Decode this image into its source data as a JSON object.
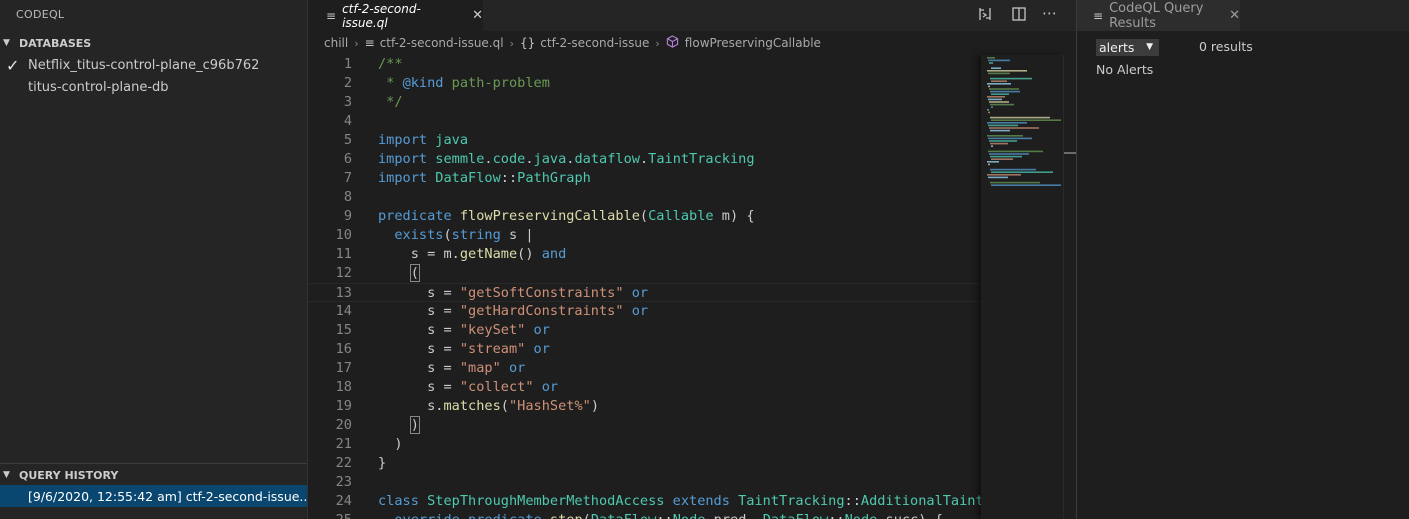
{
  "sidebar": {
    "title": "CODEQL",
    "databases": {
      "header": "DATABASES",
      "items": [
        {
          "label": "Netflix_titus-control-plane_c96b762",
          "selected": true
        },
        {
          "label": "titus-control-plane-db",
          "selected": false
        }
      ]
    },
    "query_history": {
      "header": "QUERY HISTORY",
      "items": [
        {
          "label": "[9/6/2020, 12:55:42 am] ctf-2-second-issue...."
        }
      ]
    }
  },
  "editor": {
    "tab": {
      "label": "ctf-2-second-issue.ql"
    },
    "breadcrumb": [
      "chill",
      "ctf-2-second-issue.ql",
      "ctf-2-second-issue",
      "flowPreservingCallable"
    ],
    "lines": [
      {
        "n": "1",
        "html": "<span class=\"cm\">/**</span>"
      },
      {
        "n": "2",
        "html": "<span class=\"cm\"> * </span><span class=\"kw\">@kind</span><span class=\"cm\"> path-problem</span>"
      },
      {
        "n": "3",
        "html": "<span class=\"cm\"> */</span>"
      },
      {
        "n": "4",
        "html": ""
      },
      {
        "n": "5",
        "html": "<span class=\"kw\">import</span> <span class=\"ty\">java</span>"
      },
      {
        "n": "6",
        "html": "<span class=\"kw\">import</span> <span class=\"ty\">semmle</span>.<span class=\"ty\">code</span>.<span class=\"ty\">java</span>.<span class=\"ty\">dataflow</span>.<span class=\"ty\">TaintTracking</span>"
      },
      {
        "n": "7",
        "html": "<span class=\"kw\">import</span> <span class=\"ty\">DataFlow</span>::<span class=\"ty\">PathGraph</span>"
      },
      {
        "n": "8",
        "html": ""
      },
      {
        "n": "9",
        "html": "<span class=\"kw\">predicate</span> <span class=\"fn\">flowPreservingCallable</span>(<span class=\"ty\">Callable</span> m) {"
      },
      {
        "n": "10",
        "html": "  <span class=\"kw\">exists</span>(<span class=\"kw\">string</span> s |"
      },
      {
        "n": "11",
        "html": "    s = m.<span class=\"fn\">getName</span>() <span class=\"kw\">and</span>"
      },
      {
        "n": "12",
        "html": "    <span class=\"br\">(</span>"
      },
      {
        "n": "13",
        "html": "      s = <span class=\"st\">\"getSoftConstraints\"</span> <span class=\"kw\">or</span>"
      },
      {
        "n": "14",
        "html": "      s = <span class=\"st\">\"getHardConstraints\"</span> <span class=\"kw\">or</span>"
      },
      {
        "n": "15",
        "html": "      s = <span class=\"st\">\"keySet\"</span> <span class=\"kw\">or</span>"
      },
      {
        "n": "16",
        "html": "      s = <span class=\"st\">\"stream\"</span> <span class=\"kw\">or</span>"
      },
      {
        "n": "17",
        "html": "      s = <span class=\"st\">\"map\"</span> <span class=\"kw\">or</span>"
      },
      {
        "n": "18",
        "html": "      s = <span class=\"st\">\"collect\"</span> <span class=\"kw\">or</span>"
      },
      {
        "n": "19",
        "html": "      s.<span class=\"fn\">matches</span>(<span class=\"st\">\"HashSet%\"</span>)"
      },
      {
        "n": "20",
        "html": "    <span class=\"br\">)</span>"
      },
      {
        "n": "21",
        "html": "  )"
      },
      {
        "n": "22",
        "html": "}"
      },
      {
        "n": "23",
        "html": ""
      },
      {
        "n": "24",
        "html": "<span class=\"kw\">class</span> <span class=\"ty\">StepThroughMemberMethodAccess</span> <span class=\"kw\">extends</span> <span class=\"ty\">TaintTracking</span>::<span class=\"ty\">AdditionalTaintStep</span> {"
      },
      {
        "n": "25",
        "html": "  <span class=\"kw\">override</span> <span class=\"kw\">predicate</span> <span class=\"fn\">step</span>(<span class=\"ty\">DataFlow</span>::<span class=\"ty\">Node</span> pred, <span class=\"ty\">DataFlow</span>::<span class=\"ty\">Node</span> succ) {"
      }
    ]
  },
  "results": {
    "tab": {
      "label": "CodeQL Query Results"
    },
    "select": {
      "value": "alerts"
    },
    "count": "0 results",
    "empty_message": "No Alerts"
  }
}
